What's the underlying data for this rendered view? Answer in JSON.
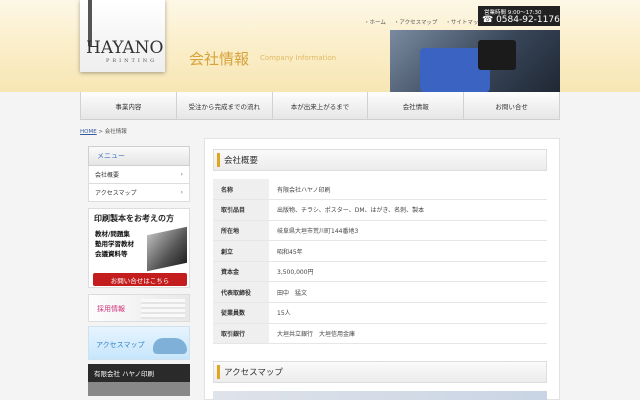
{
  "header": {
    "logo_text": "HAYANO",
    "logo_sub": "PRINTING",
    "page_title": "会社情報",
    "page_title_en": "Company Information",
    "top_links": [
      "・ホーム",
      "・アクセスマップ",
      "・サイトマップ"
    ],
    "tel_hours": "営業時間 9:00〜17:30",
    "tel_number": "☎ 0584-92-1176"
  },
  "nav": [
    "事業内容",
    "受注から完成までの流れ",
    "本が出来上がるまで",
    "会社情報",
    "お問い合せ"
  ],
  "breadcrumb": {
    "home": "HOME",
    "sep": " > ",
    "current": "会社情報"
  },
  "sidebar": {
    "menu_title": "メニュー",
    "menu_items": [
      "会社概要",
      "アクセスマップ"
    ],
    "chevron": "›",
    "banner1_title": "印刷製本をお考えの方",
    "banner1_lines": [
      "教材/問題集",
      "塾用学習教材",
      "会議資料等"
    ],
    "banner1_button": "お問い合せはこちら",
    "banner2_text": "採用情報",
    "banner3_text": "アクセスマップ",
    "company_name": "有限会社 ハヤノ印刷"
  },
  "main": {
    "section1_title": "会社概要",
    "section2_title": "アクセスマップ",
    "rows": [
      {
        "key": "名称",
        "value": "有限会社ハヤノ印刷"
      },
      {
        "key": "取引品目",
        "value": "出版物、チラシ、ポスター、DM、はがき、名刺、製本"
      },
      {
        "key": "所在地",
        "value": "岐阜県大垣市荒川町144番地3"
      },
      {
        "key": "創立",
        "value": "昭和45年"
      },
      {
        "key": "資本金",
        "value": "3,500,000円"
      },
      {
        "key": "代表取締役",
        "value": "田中　猛文"
      },
      {
        "key": "従業員数",
        "value": "15人"
      },
      {
        "key": "取引銀行",
        "value": "大垣共立銀行　大垣信用金庫"
      }
    ]
  },
  "colors": {
    "accent": "#e0a620",
    "title": "#d8a23a",
    "contact_button": "#c41d1d"
  }
}
